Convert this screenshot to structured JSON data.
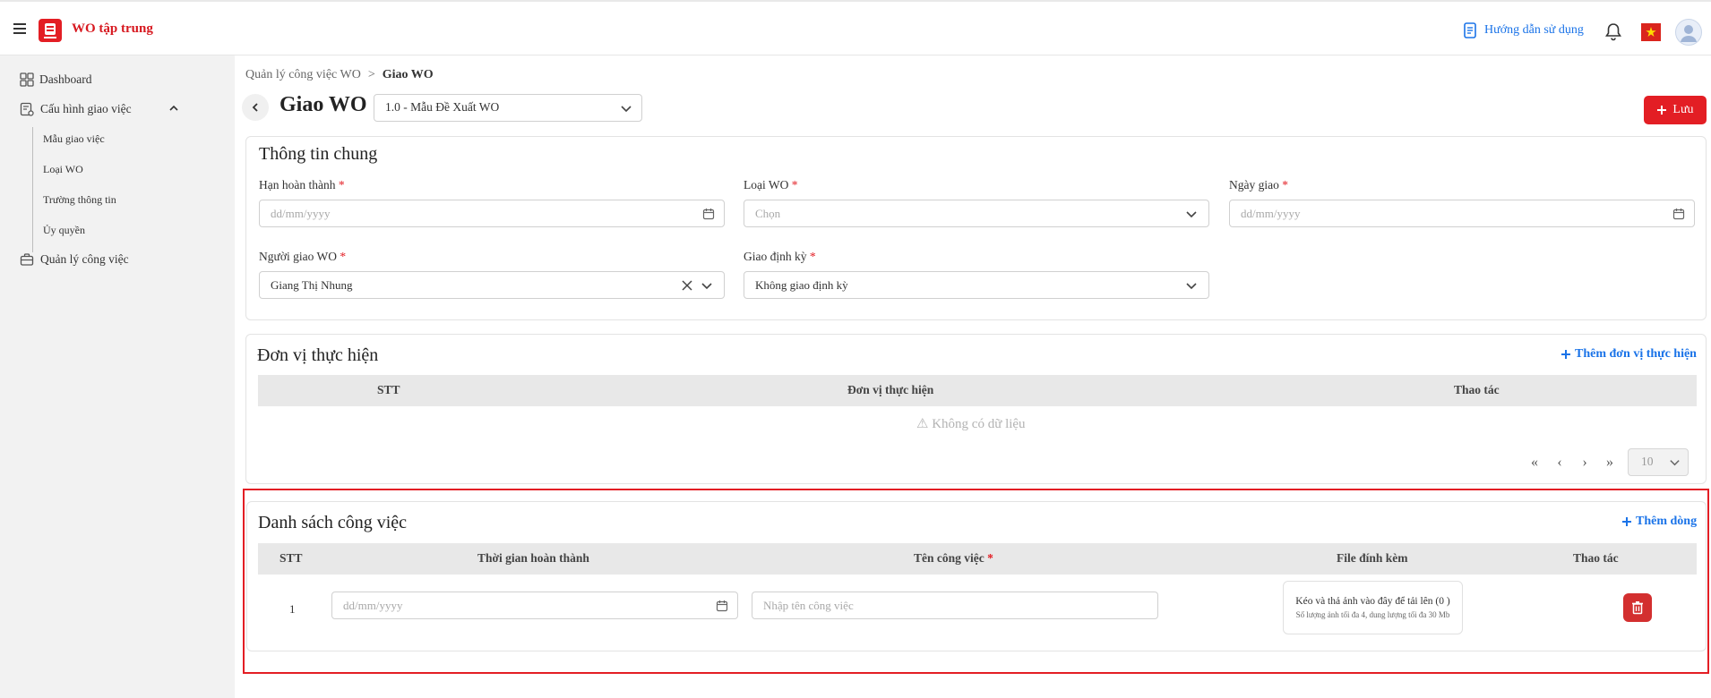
{
  "header": {
    "app_title": "WO tập trung",
    "guide_label": "Hướng dẫn sử dụng",
    "menu_icon": "menu-icon",
    "bell_icon": "bell-icon",
    "language_flag": "vietnam-flag"
  },
  "sidebar": {
    "items": [
      {
        "label": "Dashboard",
        "icon": "grid-icon"
      },
      {
        "label": "Cấu hình giao việc",
        "icon": "form-config-icon",
        "expanded": true
      },
      {
        "label": "Quản lý công việc",
        "icon": "briefcase-icon"
      }
    ],
    "sub_items": [
      {
        "label": "Mẫu giao việc"
      },
      {
        "label": "Loại WO"
      },
      {
        "label": "Trường thông tin"
      },
      {
        "label": "Ủy quyền"
      }
    ]
  },
  "breadcrumb": {
    "parent": "Quản lý công việc WO",
    "separator": ">",
    "current": "Giao WO"
  },
  "page": {
    "title": "Giao WO",
    "template_value": "1.0 - Mẫu Đề Xuất WO",
    "save_label": "Lưu"
  },
  "general": {
    "title": "Thông tin chung",
    "fields": {
      "deadline": {
        "label": "Hạn hoàn thành",
        "required": "*",
        "placeholder": "dd/mm/yyyy"
      },
      "wo_type": {
        "label": "Loại WO",
        "required": "*",
        "placeholder": "Chọn"
      },
      "assign_date": {
        "label": "Ngày giao",
        "required": "*",
        "placeholder": "dd/mm/yyyy"
      },
      "assigner": {
        "label": "Người giao WO",
        "required": "*",
        "value": "Giang Thị Nhung"
      },
      "periodic": {
        "label": "Giao định kỳ",
        "required": "*",
        "value": "Không giao định kỳ"
      }
    }
  },
  "units": {
    "title": "Đơn vị thực hiện",
    "add_label": "Thêm đơn vị thực hiện",
    "columns": [
      "STT",
      "Đơn vị thực hiện",
      "Thao tác"
    ],
    "empty_text": "⚠ Không có dữ liệu",
    "page_size": "10"
  },
  "tasks": {
    "title": "Danh sách công việc",
    "add_label": "Thêm dòng",
    "columns": {
      "stt": "STT",
      "time": "Thời gian hoàn thành",
      "name": "Tên công việc",
      "name_required": "*",
      "file": "File đính kèm",
      "action": "Thao tác"
    },
    "rows": [
      {
        "stt": "1",
        "time_placeholder": "dd/mm/yyyy",
        "name_placeholder": "Nhập tên công việc",
        "upload_main": "Kéo và thả ảnh vào đây để tải lên (0 )",
        "upload_sub": "Số lượng ảnh tối đa 4, dung lượng tối đa 30 Mb"
      }
    ]
  }
}
